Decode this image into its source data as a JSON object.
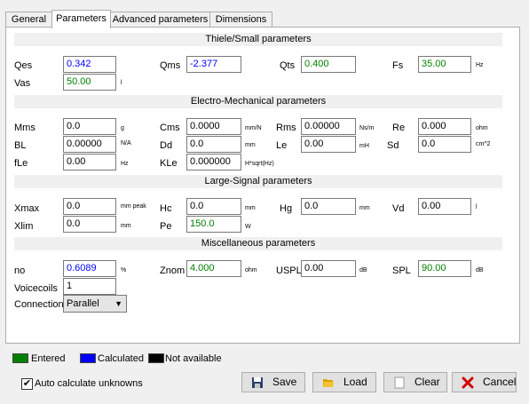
{
  "tabs": [
    "General",
    "Parameters",
    "Advanced parameters",
    "Dimensions"
  ],
  "sections": {
    "ts": "Thiele/Small parameters",
    "em": "Electro-Mechanical parameters",
    "ls": "Large-Signal parameters",
    "misc": "Miscellaneous parameters"
  },
  "ts": {
    "qes": {
      "label": "Qes",
      "value": "0.342"
    },
    "qms": {
      "label": "Qms",
      "value": "-2.377"
    },
    "qts": {
      "label": "Qts",
      "value": "0.400"
    },
    "fs": {
      "label": "Fs",
      "value": "35.00",
      "unit": "Hz"
    },
    "vas": {
      "label": "Vas",
      "value": "50.00",
      "unit": "l"
    }
  },
  "em": {
    "mms": {
      "label": "Mms",
      "value": "0.0",
      "unit": "g"
    },
    "cms": {
      "label": "Cms",
      "value": "0.0000",
      "unit": "mm/N"
    },
    "rms": {
      "label": "Rms",
      "value": "0.00000",
      "unit": "Ns/m"
    },
    "re": {
      "label": "Re",
      "value": "0.000",
      "unit": "ohm"
    },
    "bl": {
      "label": "BL",
      "value": "0.00000",
      "unit": "N/A"
    },
    "dd": {
      "label": "Dd",
      "value": "0.0",
      "unit": "mm"
    },
    "le": {
      "label": "Le",
      "value": "0.00",
      "unit": "mH"
    },
    "sd": {
      "label": "Sd",
      "value": "0.0",
      "unit": "cm^2"
    },
    "fle": {
      "label": "fLe",
      "value": "0.00",
      "unit": "Hz"
    },
    "kle": {
      "label": "KLe",
      "value": "0.000000",
      "unit": "H*sqrt(Hz)"
    }
  },
  "ls": {
    "xmax": {
      "label": "Xmax",
      "value": "0.0",
      "unit": "mm peak"
    },
    "hc": {
      "label": "Hc",
      "value": "0.0",
      "unit": "mm"
    },
    "hg": {
      "label": "Hg",
      "value": "0.0",
      "unit": "mm"
    },
    "vd": {
      "label": "Vd",
      "value": "0.00",
      "unit": "l"
    },
    "xlim": {
      "label": "Xlim",
      "value": "0.0",
      "unit": "mm"
    },
    "pe": {
      "label": "Pe",
      "value": "150.0",
      "unit": "W"
    }
  },
  "misc": {
    "no": {
      "label": "no",
      "value": "0.6089",
      "unit": "%"
    },
    "znom": {
      "label": "Znom",
      "value": "4.000",
      "unit": "ohm"
    },
    "uspl": {
      "label": "USPL",
      "value": "0.00",
      "unit": "dB"
    },
    "spl": {
      "label": "SPL",
      "value": "90.00",
      "unit": "dB"
    },
    "voicecoils": {
      "label": "Voicecoils",
      "value": "1"
    },
    "connection": {
      "label": "Connection",
      "value": "Parallel"
    }
  },
  "legend": {
    "entered": {
      "label": "Entered",
      "color": "#008000"
    },
    "calculated": {
      "label": "Calculated",
      "color": "#0000ff"
    },
    "na": {
      "label": "Not available",
      "color": "#000000"
    }
  },
  "auto_calc": {
    "label": "Auto calculate unknowns",
    "checked": true
  },
  "buttons": {
    "save": "Save",
    "load": "Load",
    "clear": "Clear",
    "cancel": "Cancel"
  }
}
